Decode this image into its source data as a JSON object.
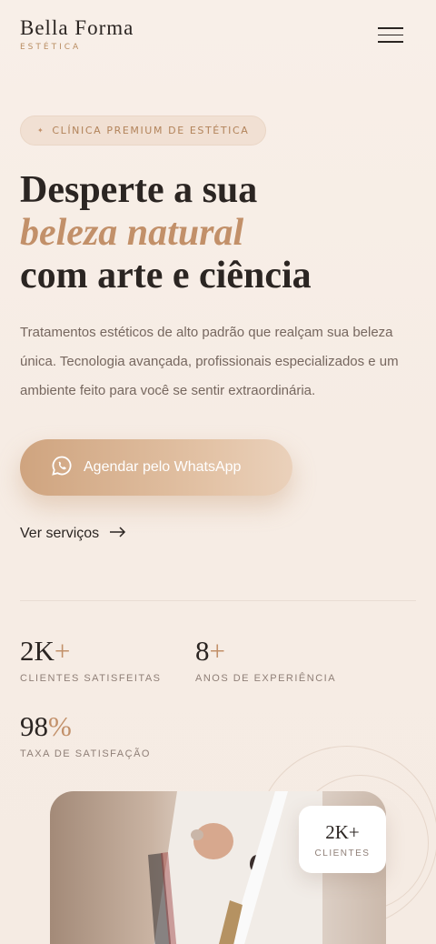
{
  "header": {
    "brand_name": "Bella Forma",
    "brand_sub": "ESTÉTICA",
    "menu_icon": "hamburger-icon"
  },
  "hero": {
    "badge": "CLÍNICA PREMIUM DE ESTÉTICA",
    "headline_1": "Desperte a sua",
    "headline_2": "beleza natural",
    "headline_3": "com arte e ciência",
    "description": "Tratamentos estéticos de alto padrão que realçam sua beleza única. Tecnologia avançada, profissionais especializados e um ambiente feito para você se sentir extraordinária.",
    "cta_label": "Agendar pelo WhatsApp",
    "cta_icon": "whatsapp-icon",
    "secondary_label": "Ver serviços",
    "secondary_icon": "arrow-right-icon"
  },
  "stats": [
    {
      "number": "2K",
      "suffix": "+",
      "label": "CLIENTES SATISFEITAS"
    },
    {
      "number": "8",
      "suffix": "+",
      "label": "ANOS DE EXPERIÊNCIA"
    },
    {
      "number": "98",
      "suffix": "%",
      "label": "TAXA DE SATISFAÇÃO"
    }
  ],
  "floating_card": {
    "value": "2K+",
    "label": "CLIENTES"
  },
  "colors": {
    "accent": "#c29069",
    "background": "#f8efe8",
    "text": "#2b2522",
    "muted": "#76675f"
  }
}
